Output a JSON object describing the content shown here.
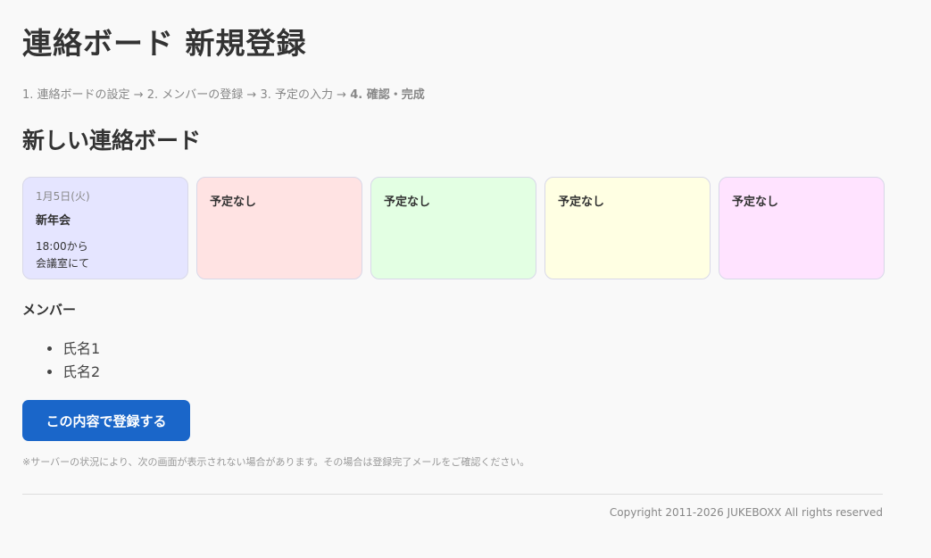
{
  "page": {
    "title": "連絡ボード 新規登録"
  },
  "steps": {
    "step1": "1. 連絡ボードの設定",
    "step2": "2. メンバーの登録",
    "step3": "3. 予定の入力",
    "step4": "4. 確認・完成",
    "arrow": "→"
  },
  "board": {
    "title": "新しい連絡ボード",
    "cards": [
      {
        "date": "1月5日(火)",
        "title": "新年会",
        "note1": "18:00から",
        "note2": "会議室にて",
        "color": "#e5e5ff"
      },
      {
        "empty": "予定なし",
        "color": "#ffe3e3"
      },
      {
        "empty": "予定なし",
        "color": "#e3ffe3"
      },
      {
        "empty": "予定なし",
        "color": "#ffffe3"
      },
      {
        "empty": "予定なし",
        "color": "#ffe3ff"
      }
    ]
  },
  "members": {
    "title": "メンバー",
    "items": [
      "氏名1",
      "氏名2"
    ]
  },
  "actions": {
    "submit_label": "この内容で登録する"
  },
  "notice": {
    "text": "※サーバーの状況により、次の画面が表示されない場合があります。その場合は登録完了メールをご確認ください。"
  },
  "footer": {
    "copyright": "Copyright 2011-2026 JUKEBOXX All rights reserved"
  },
  "colors": {
    "primary_button": "#1a66c9"
  }
}
